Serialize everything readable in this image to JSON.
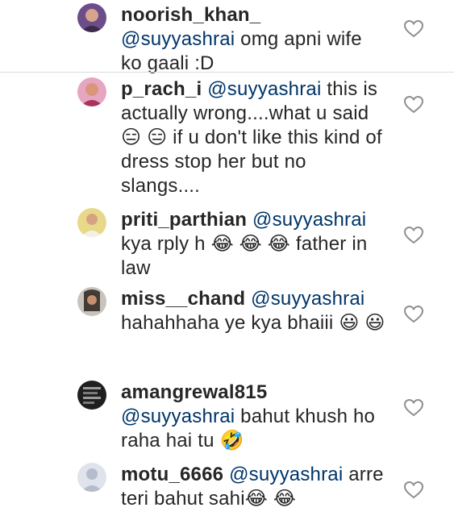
{
  "comments": [
    {
      "username": "noorish_khan_",
      "mention": "@suyyashrai",
      "body": "  omg apni wife ko gaali :D",
      "avatar_color": "#6b4d8a"
    },
    {
      "username": "p_rach_i",
      "mention": "@suyyashrai",
      "body": " this is actually wrong....what u said😑 😑  if u don't like this kind of dress stop her but no slangs....",
      "avatar_color": "#c96b8e"
    },
    {
      "username": "priti_parthian",
      "mention": "@suyyashrai",
      "body": " kya rply h 😂 😂 😂  father in law",
      "avatar_color": "#c7b15a"
    },
    {
      "username": "miss__chand",
      "mention": "@suyyashrai",
      "body": " hahahhaha ye kya bhaiii 😃 😃",
      "avatar_color": "#3e3a36"
    },
    {
      "username": "amangrewal815",
      "mention": "@suyyashrai",
      "body": " bahut khush ho raha hai tu 🤣",
      "avatar_color": "#2c2c2c"
    },
    {
      "username": "motu_6666",
      "mention": "@suyyashrai",
      "body": " arre teri bahut sahi😂 😂",
      "avatar_color": "#c9cdd9"
    }
  ]
}
